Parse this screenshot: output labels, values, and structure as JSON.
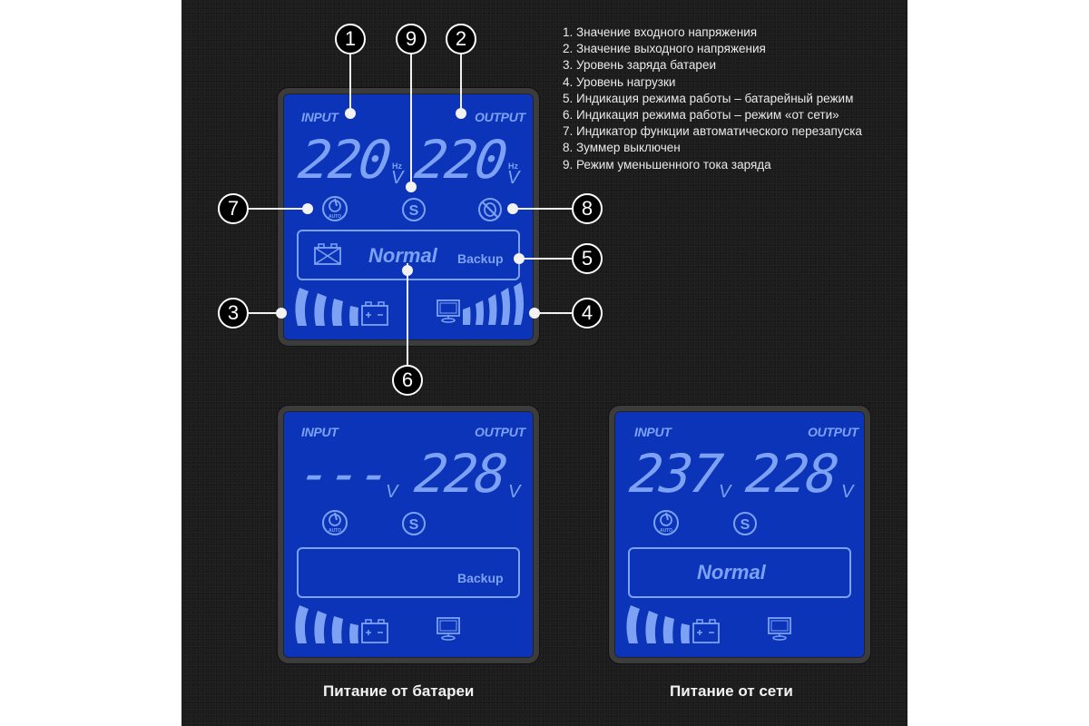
{
  "legend": [
    "1. Значение входного напряжения",
    "2. Значение выходного напряжения",
    "3. Уровень заряда батареи",
    "4. Уровень нагрузки",
    "5. Индикация режима работы – батарейный режим",
    "6. Индикация режима работы – режим «от сети»",
    "7. Индикатор функции автоматического перезапуска",
    "8. Зуммер выключен",
    "9. Режим уменьшенного тока заряда"
  ],
  "top_panel": {
    "input_label": "INPUT",
    "output_label": "OUTPUT",
    "input_value": "220",
    "output_value": "220",
    "hz": "Hz",
    "unit": "V",
    "mode_normal": "Normal",
    "mode_backup": "Backup",
    "auto_text": "AUTO",
    "s_text": "S",
    "callouts": [
      "1",
      "9",
      "2",
      "7",
      "8",
      "5",
      "3",
      "4",
      "6"
    ],
    "battery_level_bars": 4,
    "load_level_bars": 5
  },
  "battery_panel": {
    "input_label": "INPUT",
    "output_label": "OUTPUT",
    "input_value": "---",
    "output_value": "228",
    "unit": "V",
    "mode_text": "Backup",
    "auto_text": "AUTO",
    "s_text": "S",
    "battery_level_bars": 4,
    "load_level_bars": 0,
    "caption": "Питание от батареи"
  },
  "mains_panel": {
    "input_label": "INPUT",
    "output_label": "OUTPUT",
    "input_value": "237",
    "output_value": "228",
    "unit": "V",
    "mode_text": "Normal",
    "auto_text": "AUTO",
    "s_text": "S",
    "battery_level_bars": 4,
    "load_level_bars": 0,
    "caption": "Питание от сети"
  },
  "colors": {
    "lcd_background": "#0c34b8",
    "lcd_segment": "#7ea2f3",
    "bezel": "#3c3c3c",
    "page_background": "#1c1c1c"
  }
}
